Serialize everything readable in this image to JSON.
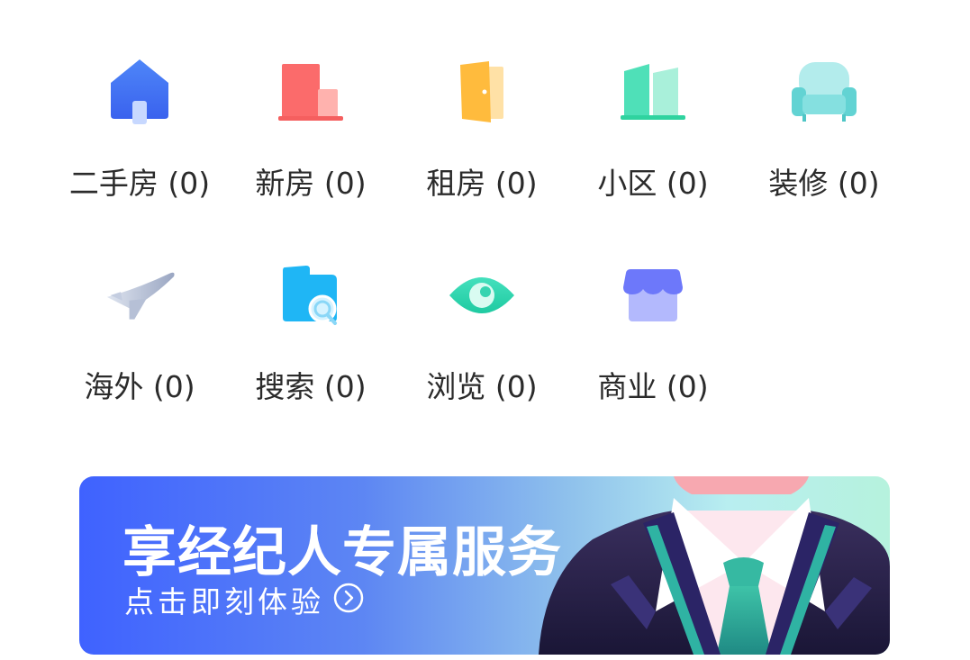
{
  "categories": [
    {
      "label": "二手房 (0)",
      "icon": "house-icon"
    },
    {
      "label": "新房 (0)",
      "icon": "building-icon"
    },
    {
      "label": "租房 (0)",
      "icon": "door-icon"
    },
    {
      "label": "小区 (0)",
      "icon": "community-icon"
    },
    {
      "label": "装修 (0)",
      "icon": "sofa-icon"
    },
    {
      "label": "海外 (0)",
      "icon": "airplane-icon"
    },
    {
      "label": "搜索 (0)",
      "icon": "search-folder-icon"
    },
    {
      "label": "浏览 (0)",
      "icon": "eye-icon"
    },
    {
      "label": "商业 (0)",
      "icon": "shop-icon"
    }
  ],
  "banner": {
    "title": "享经纪人专属服务",
    "subtitle": "点击即刻体验",
    "icon": "arrow-right-circle-icon"
  },
  "colors": {
    "house": "#4a7cf6",
    "building": "#fb6b6b",
    "door": "#ffbb3d",
    "community": "#4fe0b8",
    "sofa": "#6fd8d8",
    "airplane": "#a9b4cc",
    "search": "#1fb6f5",
    "eye": "#2ed6b0",
    "shop": "#7b84fb",
    "banner_start": "#3f62ff",
    "banner_end": "#b6f2dd"
  }
}
